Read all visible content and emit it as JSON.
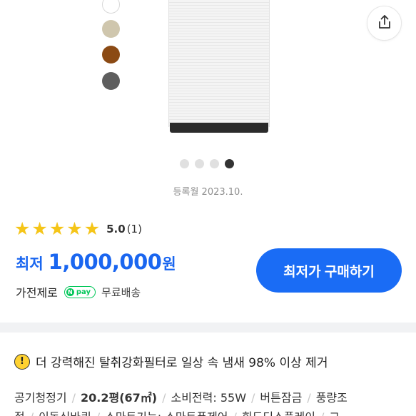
{
  "product": {
    "swatches": [
      "#ffffff",
      "#cfc6ad",
      "#8b4a14",
      "#5e5e5e"
    ],
    "image_page": 4,
    "image_total": 4,
    "registered": "등록월 2023.10."
  },
  "rating": {
    "stars": 5,
    "score": "5.0",
    "count": "(1)"
  },
  "price": {
    "prefix": "최저",
    "value": "1,000,000",
    "unit": "원"
  },
  "seller": {
    "name": "가전제로",
    "npay_letter": "N",
    "npay_label": "pay",
    "shipping": "무료배송"
  },
  "buy_button": {
    "label": "최저가 구매하기"
  },
  "notice": {
    "icon": "!",
    "text": "더 강력해진 탈취강화필터로 일상 속 냄새 98% 이상 제거"
  },
  "specs": {
    "row1": [
      "공기청정기",
      "20.2평(67㎡)",
      "소비전력: 55W",
      "버튼잠금",
      "풍량조"
    ],
    "row2": [
      "절",
      "이동식바퀴",
      "스마트기능: 스마트폰제어",
      "회도디스플레이",
      "그"
    ]
  },
  "colors": {
    "accent": "#1a6cf5",
    "npay": "#03c75a",
    "star": "#f5c518"
  }
}
